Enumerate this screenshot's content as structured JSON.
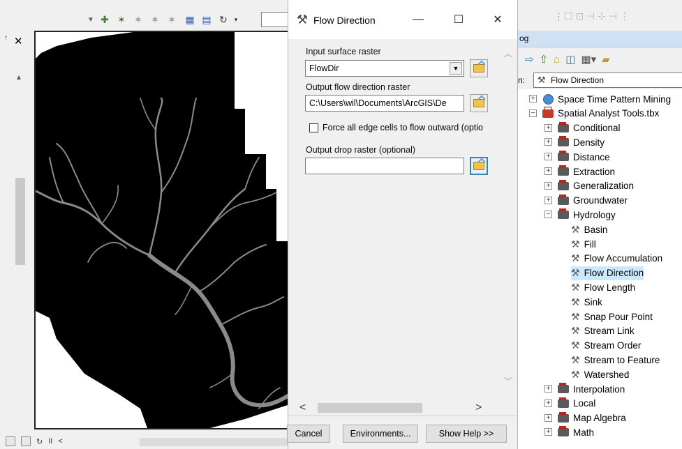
{
  "dialog": {
    "title": "Flow Direction",
    "minimize_label": "—",
    "maximize_label": "☐",
    "close_label": "✕",
    "input_surface_label": "Input surface raster",
    "input_surface_value": "FlowDir",
    "output_flow_label": "Output flow direction raster",
    "output_flow_value": "C:\\Users\\wil\\Documents\\ArcGIS\\De",
    "force_edge_label": "Force all edge cells to flow outward (optio",
    "force_edge_checked": false,
    "output_drop_label": "Output drop raster (optional)",
    "output_drop_value": "",
    "buttons": {
      "cancel": "Cancel",
      "environments": "Environments...",
      "show_help": "Show Help >>"
    }
  },
  "catalog": {
    "header": "og",
    "location_label": "n:",
    "location_value": "Flow Direction",
    "tree": [
      {
        "label": "Space Time Pattern Mining",
        "icon": "toolbox-icon",
        "expander": "+",
        "level": 0
      },
      {
        "label": "Spatial Analyst Tools.tbx",
        "icon": "toolbox-icon",
        "expander": "−",
        "level": 0
      },
      {
        "label": "Conditional",
        "icon": "toolset-icon",
        "expander": "+",
        "level": 1
      },
      {
        "label": "Density",
        "icon": "toolset-icon",
        "expander": "+",
        "level": 1
      },
      {
        "label": "Distance",
        "icon": "toolset-icon",
        "expander": "+",
        "level": 1
      },
      {
        "label": "Extraction",
        "icon": "toolset-icon",
        "expander": "+",
        "level": 1
      },
      {
        "label": "Generalization",
        "icon": "toolset-icon",
        "expander": "+",
        "level": 1
      },
      {
        "label": "Groundwater",
        "icon": "toolset-icon",
        "expander": "+",
        "level": 1
      },
      {
        "label": "Hydrology",
        "icon": "toolset-icon",
        "expander": "−",
        "level": 1
      },
      {
        "label": "Basin",
        "icon": "hammer-icon",
        "expander": "",
        "level": 2
      },
      {
        "label": "Fill",
        "icon": "hammer-icon",
        "expander": "",
        "level": 2
      },
      {
        "label": "Flow Accumulation",
        "icon": "hammer-icon",
        "expander": "",
        "level": 2
      },
      {
        "label": "Flow Direction",
        "icon": "hammer-icon",
        "expander": "",
        "level": 2,
        "selected": true
      },
      {
        "label": "Flow Length",
        "icon": "hammer-icon",
        "expander": "",
        "level": 2
      },
      {
        "label": "Sink",
        "icon": "hammer-icon",
        "expander": "",
        "level": 2
      },
      {
        "label": "Snap Pour Point",
        "icon": "hammer-icon",
        "expander": "",
        "level": 2
      },
      {
        "label": "Stream Link",
        "icon": "hammer-icon",
        "expander": "",
        "level": 2
      },
      {
        "label": "Stream Order",
        "icon": "hammer-icon",
        "expander": "",
        "level": 2
      },
      {
        "label": "Stream to Feature",
        "icon": "hammer-icon",
        "expander": "",
        "level": 2
      },
      {
        "label": "Watershed",
        "icon": "hammer-icon",
        "expander": "",
        "level": 2
      },
      {
        "label": "Interpolation",
        "icon": "toolset-icon",
        "expander": "+",
        "level": 1
      },
      {
        "label": "Local",
        "icon": "toolset-icon",
        "expander": "+",
        "level": 1
      },
      {
        "label": "Map Algebra",
        "icon": "toolset-icon",
        "expander": "+",
        "level": 1
      },
      {
        "label": "Math",
        "icon": "toolset-icon",
        "expander": "+",
        "level": 1
      }
    ]
  },
  "map": {
    "close_label": "✕",
    "status_pause": "II",
    "status_back": "<"
  },
  "colors": {
    "raster_background": "#000000",
    "stream": "#8a8a8a",
    "selection": "#cce8ff",
    "catalog_header": "#cfe1f3"
  }
}
